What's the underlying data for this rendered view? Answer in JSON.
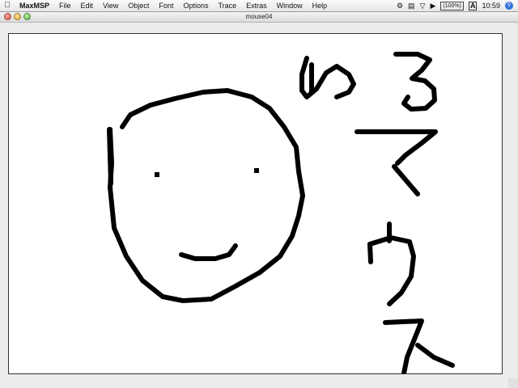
{
  "menubar": {
    "apple_icon": "apple-icon",
    "app_name": "MaxMSP",
    "items": [
      "File",
      "Edit",
      "View",
      "Object",
      "Font",
      "Options",
      "Trace",
      "Extras",
      "Window",
      "Help"
    ],
    "battery": "(100%)",
    "keyboard_indicator": "A",
    "time": "10:59",
    "tray_icons": [
      "script-menu-icon",
      "display-icon",
      "wifi-icon",
      "volume-icon",
      "battery-icon",
      "input-menu-icon",
      "spotlight-icon"
    ]
  },
  "window": {
    "title": "mouse04",
    "buttons": [
      "close",
      "minimize",
      "zoom"
    ]
  },
  "drawing": {
    "stroke_color": "#000000",
    "background_color": "#ffffff"
  }
}
